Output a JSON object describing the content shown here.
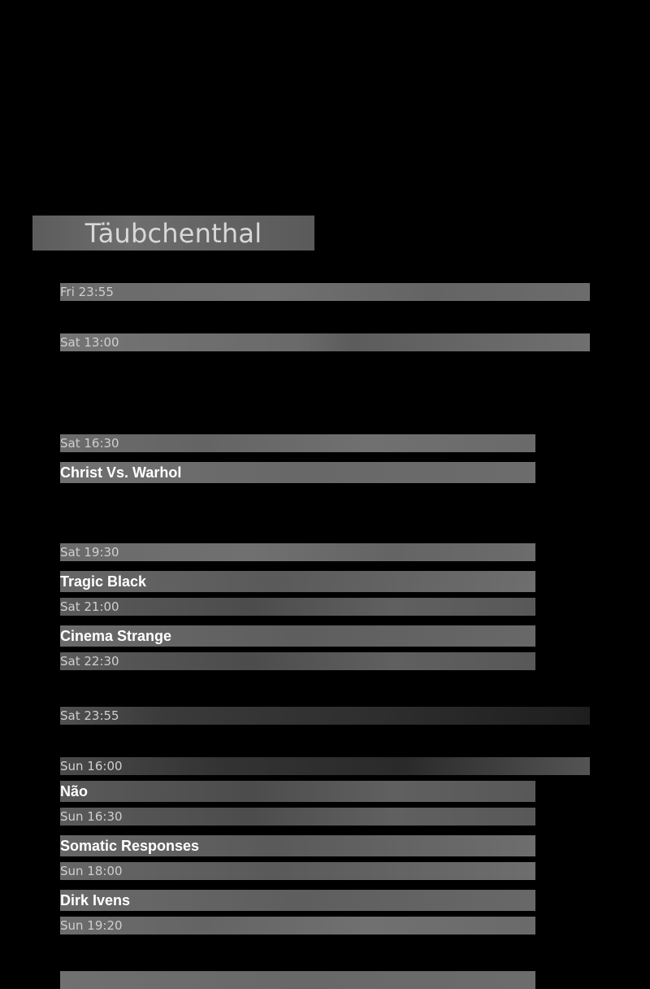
{
  "venue": {
    "name": "Täubchenthal"
  },
  "schedule": [
    {
      "time": "Fri 23:55"
    },
    {
      "time": "Sat 13:00"
    },
    {
      "time": "Sat 16:30",
      "band": "Christ Vs. Warhol"
    },
    {
      "time": "Sat 19:30",
      "band": "Tragic Black"
    },
    {
      "time": "Sat 21:00",
      "band": "Cinema Strange"
    },
    {
      "time": "Sat 22:30"
    },
    {
      "time": "Sat 23:55"
    },
    {
      "time": "Sun 16:00",
      "band": "Não"
    },
    {
      "time": "Sun 16:30",
      "band": "Somatic Responses"
    },
    {
      "time": "Sun 18:00",
      "band": "Dirk Ivens"
    },
    {
      "time": "Sun 19:20"
    }
  ]
}
